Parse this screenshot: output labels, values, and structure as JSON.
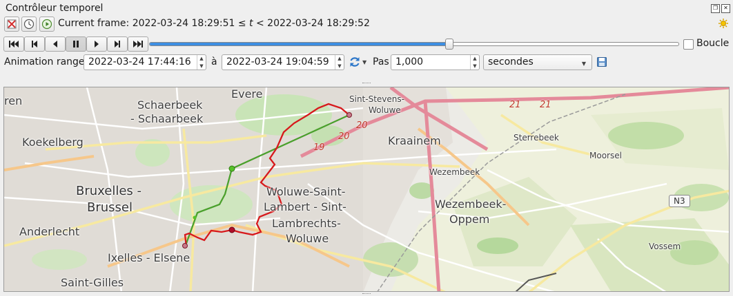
{
  "panel": {
    "title": "Contrôleur temporel"
  },
  "toolbar": {
    "disable_icon": "temporal-disabled-icon",
    "fixed_range_icon": "clock-icon",
    "animated_icon": "play-circle-icon",
    "current_frame_text": "Current frame: 2022-03-24 18:29:51 ≤ t < 2022-03-24 18:29:52",
    "settings_icon": "settings-sun-icon"
  },
  "playback": {
    "buttons": [
      "rewind-to-start",
      "previous-frame",
      "play-backward",
      "pause",
      "play-forward",
      "next-frame",
      "skip-to-end"
    ],
    "slider_position": 0.567,
    "loop_label": "Boucle",
    "loop_checked": false
  },
  "range": {
    "label": "Animation range",
    "start": "2022-03-24 17:44:16",
    "to_label": "à",
    "end": "2022-03-24 19:04:59",
    "step_label": "Pas",
    "step_value": "1,000",
    "unit": "secondes"
  },
  "map": {
    "labels": {
      "evere": "Evere",
      "schaerbeek": "Schaerbeek",
      "schaarbeek": "- Schaarbeek",
      "koekelberg": "Koekelberg",
      "bruxelles": "Bruxelles -",
      "brussel": "Brussel",
      "anderlecht": "Anderlecht",
      "ixelles": "Ixelles - Elsene",
      "saint_gilles": "Saint-Gilles",
      "ren": "ren",
      "sint_stevens": "Sint-Stevens-",
      "woluwe_top": "Woluwe",
      "kraainem": "Kraainem",
      "sterrebeek": "Sterrebeek",
      "moorsel": "Moorsel",
      "wezembeek": "Wezembeek",
      "wezembeek_oppem_1": "Wezembeek-",
      "wezembeek_oppem_2": "Oppem",
      "wsl_1": "Woluwe-Saint-",
      "wsl_2": "Lambert - Sint-",
      "wsl_3": "Lambrechts-",
      "wsl_4": "Woluwe",
      "vossem": "Vossem"
    },
    "road_numbers": {
      "r20a": "20",
      "r20b": "20",
      "r19": "19",
      "r21a": "21",
      "r21b": "21"
    },
    "shield": "N3",
    "colors": {
      "track_red": "#d7191c",
      "track_green": "#4aa02c",
      "point_green": "#58c22a",
      "point_red": "#b0102a"
    }
  }
}
